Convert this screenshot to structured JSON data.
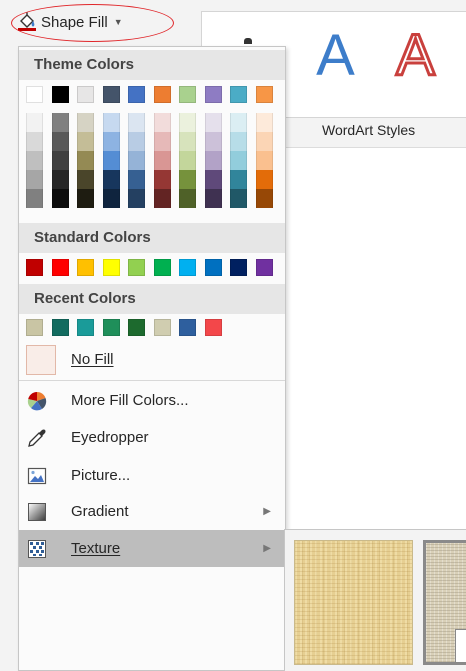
{
  "ribbon": {
    "shape_fill_label": "Shape Fill",
    "wordart_letter": "A",
    "wordart_styles_label": "WordArt Styles"
  },
  "menu": {
    "theme_colors_header": "Theme Colors",
    "standard_colors_header": "Standard Colors",
    "recent_colors_header": "Recent Colors",
    "theme_top_row": [
      "#ffffff",
      "#000000",
      "#e7e6e6",
      "#44546a",
      "#4472c4",
      "#ed7d31",
      "#a9d18e",
      "#8e7cc3",
      "#4bacc6",
      "#f79646"
    ],
    "theme_gradient_columns": [
      [
        "#f2f2f2",
        "#d9d9d9",
        "#bfbfbf",
        "#a6a6a6",
        "#808080"
      ],
      [
        "#808080",
        "#595959",
        "#404040",
        "#262626",
        "#0d0d0d"
      ],
      [
        "#d6d3c4",
        "#c4bd97",
        "#948a54",
        "#4a452a",
        "#1e1c11"
      ],
      [
        "#c6d9f0",
        "#8db3e2",
        "#548dd4",
        "#17365d",
        "#0f243e"
      ],
      [
        "#dbe5f1",
        "#b8cce4",
        "#95b3d7",
        "#366092",
        "#244061"
      ],
      [
        "#f2dcdb",
        "#e6b9b8",
        "#d99694",
        "#953734",
        "#632423"
      ],
      [
        "#ebf1dd",
        "#d7e3bc",
        "#c3d69b",
        "#76923c",
        "#4f6128"
      ],
      [
        "#e5e0ec",
        "#ccc1d9",
        "#b2a2c7",
        "#5f497a",
        "#3f3151"
      ],
      [
        "#dbeef3",
        "#b7dde8",
        "#92cddc",
        "#31859b",
        "#205867"
      ],
      [
        "#fdeada",
        "#fbd5b5",
        "#fac08f",
        "#e36c09",
        "#974806"
      ]
    ],
    "standard_colors": [
      "#c00000",
      "#ff0000",
      "#ffc000",
      "#ffff00",
      "#92d050",
      "#00b050",
      "#00b0f0",
      "#0070c0",
      "#002060",
      "#7030a0"
    ],
    "recent_colors": [
      "#c9c5a4",
      "#126b5f",
      "#1a9b99",
      "#1f8f5a",
      "#1d6a2e",
      "#d0cdb0",
      "#2e5f9e",
      "#f3474a"
    ],
    "no_fill_label": "No Fill",
    "more_fill_colors_label": "More Fill Colors...",
    "eyedropper_label": "Eyedropper",
    "picture_label": "Picture...",
    "gradient_label": "Gradient",
    "texture_label": "Texture"
  },
  "icons": {
    "bucket": "paint-bucket-icon",
    "more_colors": "color-wheel-icon",
    "eyedropper": "eyedropper-icon",
    "picture": "picture-icon",
    "gradient": "gradient-icon",
    "texture": "texture-icon",
    "submenu_arrow": "chevron-right-icon"
  }
}
